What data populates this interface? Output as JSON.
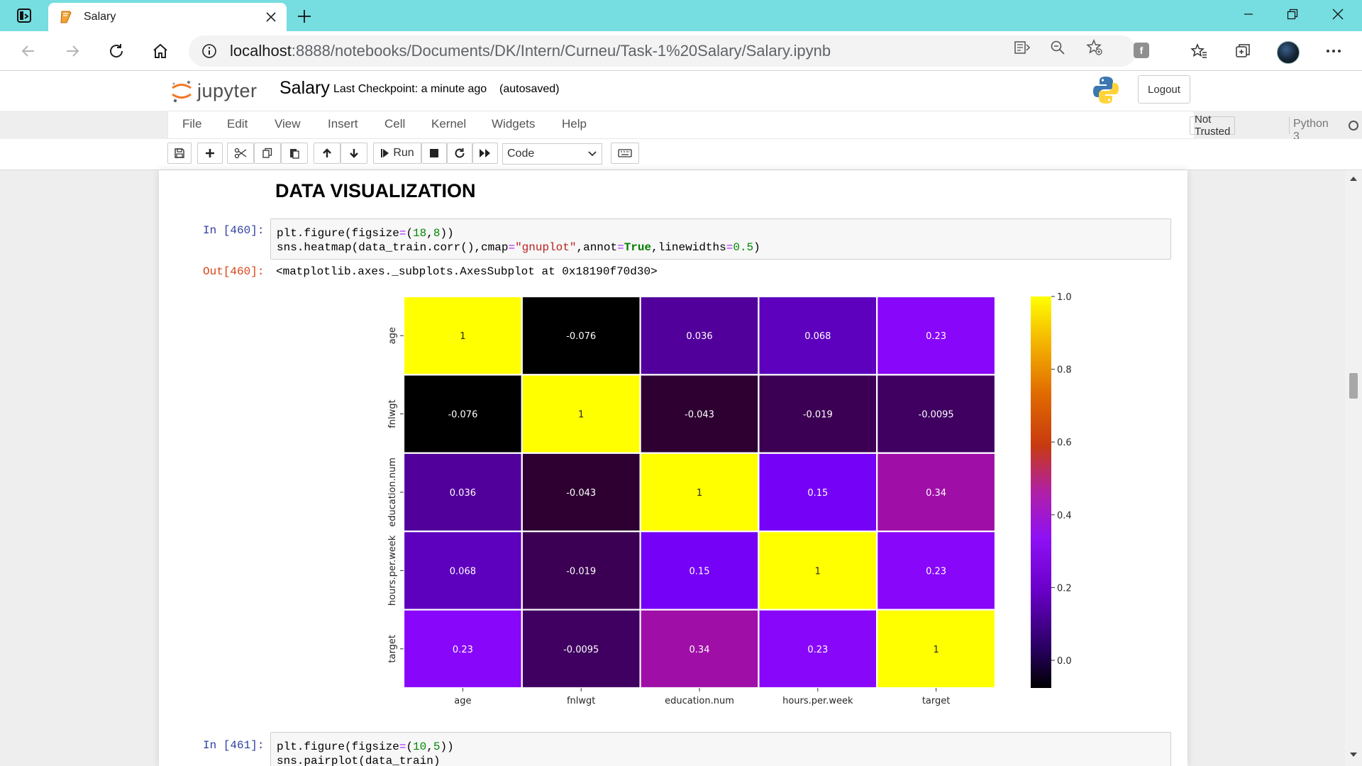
{
  "browser": {
    "tab_title": "Salary",
    "url_host": "localhost",
    "url_rest": ":8888/notebooks/Documents/DK/Intern/Curneu/Task-1%20Salary/Salary.ipynb"
  },
  "jupyter": {
    "logo_text": "jupyter",
    "notebook_name": "Salary",
    "checkpoint": "Last Checkpoint: a minute ago",
    "autosave": "(autosaved)",
    "logout": "Logout",
    "menu": [
      "File",
      "Edit",
      "View",
      "Insert",
      "Cell",
      "Kernel",
      "Widgets",
      "Help"
    ],
    "trust": "Not Trusted",
    "kernel": "Python 3",
    "run_label": "Run",
    "cell_type": "Code"
  },
  "notebook": {
    "heading": "DATA VISUALIZATION",
    "cell1": {
      "prompt_in": "In [460]:",
      "line1": {
        "a": "plt.figure(figsize",
        "op1": "=",
        "b": "(",
        "n1": "18",
        "c": ",",
        "n2": "8",
        "d": "))"
      },
      "line2": {
        "a": "sns.heatmap(data_train.corr(),cmap",
        "op1": "=",
        "s": "\"gnuplot\"",
        "b": ",annot",
        "op2": "=",
        "kw": "True",
        "c": ",linewidths",
        "op3": "=",
        "n": "0.5",
        "d": ")"
      },
      "prompt_out": "Out[460]:",
      "output": "<matplotlib.axes._subplots.AxesSubplot at 0x18190f70d30>"
    },
    "cell2": {
      "prompt_in": "In [461]:",
      "line1": {
        "a": "plt.figure(figsize",
        "op1": "=",
        "b": "(",
        "n1": "10",
        "c": ",",
        "n2": "5",
        "d": "))"
      },
      "line2": "sns.pairplot(data_train)"
    }
  },
  "chart_data": {
    "type": "heatmap",
    "colormap": "gnuplot",
    "row_labels": [
      "age",
      "fnlwgt",
      "education.num",
      "hours.per.week",
      "target"
    ],
    "col_labels": [
      "age",
      "fnlwgt",
      "education.num",
      "hours.per.week",
      "target"
    ],
    "values": [
      [
        1,
        -0.076,
        0.036,
        0.068,
        0.23
      ],
      [
        -0.076,
        1,
        -0.043,
        -0.019,
        -0.0095
      ],
      [
        0.036,
        -0.043,
        1,
        0.15,
        0.34
      ],
      [
        0.068,
        -0.019,
        0.15,
        1,
        0.23
      ],
      [
        0.23,
        -0.0095,
        0.34,
        0.23,
        1
      ]
    ],
    "annotations": [
      [
        "1",
        "-0.076",
        "0.036",
        "0.068",
        "0.23"
      ],
      [
        "-0.076",
        "1",
        "-0.043",
        "-0.019",
        "-0.0095"
      ],
      [
        "0.036",
        "-0.043",
        "1",
        "0.15",
        "0.34"
      ],
      [
        "0.068",
        "-0.019",
        "0.15",
        "1",
        "0.23"
      ],
      [
        "0.23",
        "-0.0095",
        "0.34",
        "0.23",
        "1"
      ]
    ],
    "colorbar": {
      "range": [
        -0.076,
        1
      ],
      "ticks": [
        "1.0",
        "0.8",
        "0.6",
        "0.4",
        "0.2",
        "0.0"
      ],
      "tick_values": [
        1.0,
        0.8,
        0.6,
        0.4,
        0.2,
        0.0
      ]
    }
  },
  "colors": {
    "tabbar": "#76dde0",
    "prompt_in": "#303f9f",
    "prompt_out": "#d84315"
  }
}
